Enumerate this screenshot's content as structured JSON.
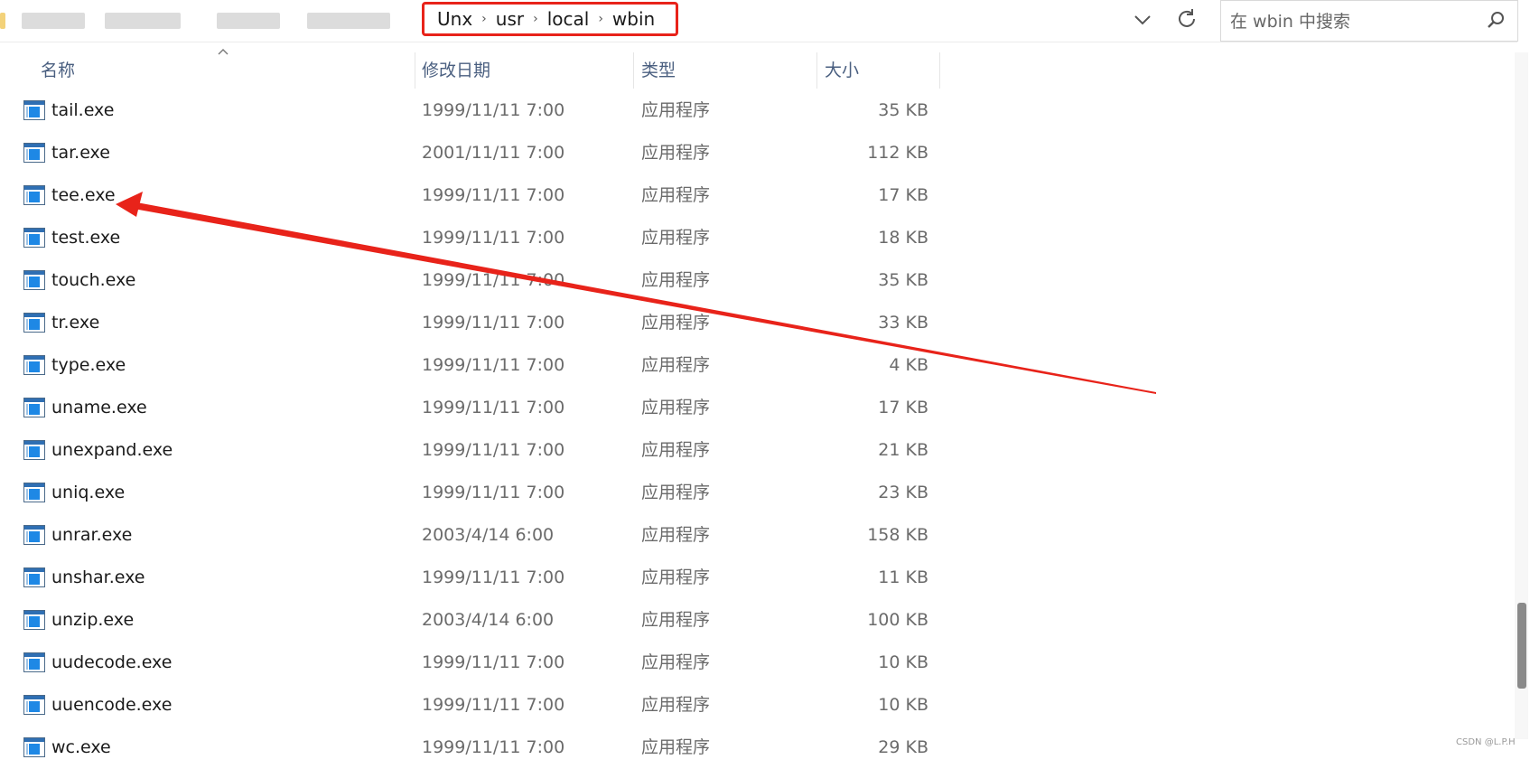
{
  "breadcrumb": [
    "Unx",
    "usr",
    "local",
    "wbin"
  ],
  "search": {
    "placeholder": "在 wbin 中搜索"
  },
  "columns": {
    "name": "名称",
    "date": "修改日期",
    "type": "类型",
    "size": "大小"
  },
  "files": [
    {
      "name": "tail.exe",
      "date": "1999/11/11 7:00",
      "type": "应用程序",
      "size": "35 KB"
    },
    {
      "name": "tar.exe",
      "date": "2001/11/11 7:00",
      "type": "应用程序",
      "size": "112 KB"
    },
    {
      "name": "tee.exe",
      "date": "1999/11/11 7:00",
      "type": "应用程序",
      "size": "17 KB"
    },
    {
      "name": "test.exe",
      "date": "1999/11/11 7:00",
      "type": "应用程序",
      "size": "18 KB"
    },
    {
      "name": "touch.exe",
      "date": "1999/11/11 7:00",
      "type": "应用程序",
      "size": "35 KB"
    },
    {
      "name": "tr.exe",
      "date": "1999/11/11 7:00",
      "type": "应用程序",
      "size": "33 KB"
    },
    {
      "name": "type.exe",
      "date": "1999/11/11 7:00",
      "type": "应用程序",
      "size": "4 KB"
    },
    {
      "name": "uname.exe",
      "date": "1999/11/11 7:00",
      "type": "应用程序",
      "size": "17 KB"
    },
    {
      "name": "unexpand.exe",
      "date": "1999/11/11 7:00",
      "type": "应用程序",
      "size": "21 KB"
    },
    {
      "name": "uniq.exe",
      "date": "1999/11/11 7:00",
      "type": "应用程序",
      "size": "23 KB"
    },
    {
      "name": "unrar.exe",
      "date": "2003/4/14 6:00",
      "type": "应用程序",
      "size": "158 KB"
    },
    {
      "name": "unshar.exe",
      "date": "1999/11/11 7:00",
      "type": "应用程序",
      "size": "11 KB"
    },
    {
      "name": "unzip.exe",
      "date": "2003/4/14 6:00",
      "type": "应用程序",
      "size": "100 KB"
    },
    {
      "name": "uudecode.exe",
      "date": "1999/11/11 7:00",
      "type": "应用程序",
      "size": "10 KB"
    },
    {
      "name": "uuencode.exe",
      "date": "1999/11/11 7:00",
      "type": "应用程序",
      "size": "10 KB"
    },
    {
      "name": "wc.exe",
      "date": "1999/11/11 7:00",
      "type": "应用程序",
      "size": "29 KB"
    }
  ],
  "icons": {
    "dropdown": "chevron-down-icon",
    "refresh": "refresh-icon",
    "search": "search-icon",
    "file": "exe-file-icon",
    "sort": "sort-ascending-icon"
  },
  "annotation": {
    "highlight_color": "#e8231a",
    "arrow_color": "#e8231a"
  },
  "scrollbar_position": 0.85,
  "watermark": "CSDN @L.P.H"
}
